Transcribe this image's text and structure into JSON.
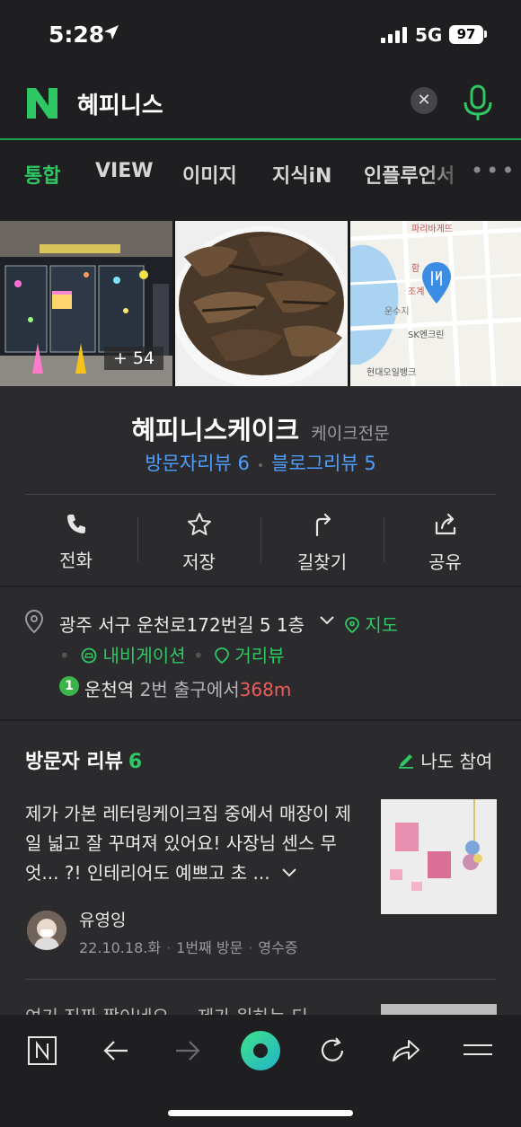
{
  "status_bar": {
    "time": "5:28",
    "network": "5G",
    "battery": "97"
  },
  "search": {
    "query": "혜피니스",
    "logo": "N"
  },
  "tabs": [
    {
      "label": "통합",
      "active": true
    },
    {
      "label": "VIEW",
      "active": false
    },
    {
      "label": "이미지",
      "active": false
    },
    {
      "label": "지식iN",
      "active": false
    },
    {
      "label": "인플루언서",
      "active": false
    }
  ],
  "photos": {
    "more_count": "+ 54"
  },
  "place": {
    "name": "혜피니스케이크",
    "category": "케이크전문",
    "visitor_reviews": "방문자리뷰 6",
    "blog_reviews": "블로그리뷰 5"
  },
  "actions": {
    "call": "전화",
    "save": "저장",
    "directions": "길찾기",
    "share": "공유"
  },
  "address": {
    "text": "광주 서구 운천로172번길 5 1층",
    "map": "지도",
    "navigation": "내비게이션",
    "street_view": "거리뷰",
    "subway_line": "1",
    "station": "운천역",
    "exit": "2번 출구에서",
    "distance": "368m"
  },
  "reviews": {
    "title": "방문자 리뷰",
    "count": "6",
    "join": "나도 참여",
    "items": [
      {
        "text": "제가 가본 레터링케이크집 중에서 매장이 제일 넓고 잘 꾸며져 있어요! 사장님 센스 무엇... ?! 인테리어도 예쁘고 초 ...",
        "author": "유영잉",
        "date": "22.10.18.화",
        "visit": "1번째 방문",
        "proof": "영수증"
      }
    ],
    "next_hint": "여기 진짜 짱이네요 ... 제가 원하는 디"
  },
  "colors": {
    "accent": "#2fc763",
    "link": "#4e9dff",
    "distance": "#f05b5b",
    "background": "#2b2b2d"
  }
}
